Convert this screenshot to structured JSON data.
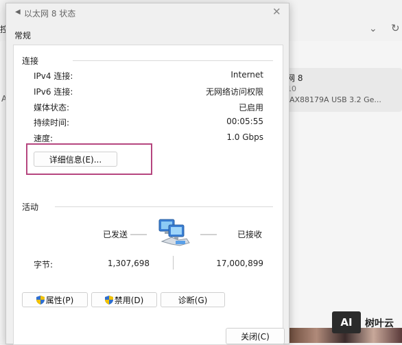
{
  "background": {
    "left_fragment": "控",
    "left_fragment2": "A",
    "card": {
      "line1": "网 8",
      "line2": "10",
      "line3": "AX88179A USB 3.2 Ge..."
    },
    "watermark": {
      "logo": "AI",
      "text": "树叶云"
    }
  },
  "dialog": {
    "title": "以太网 8 状态",
    "tab": "常规",
    "connection": {
      "title": "连接",
      "rows": [
        {
          "label": "IPv4 连接:",
          "value": "Internet"
        },
        {
          "label": "IPv6 连接:",
          "value": "无网络访问权限"
        },
        {
          "label": "媒体状态:",
          "value": "已启用"
        },
        {
          "label": "持续时间:",
          "value": "00:05:55"
        },
        {
          "label": "速度:",
          "value": "1.0 Gbps"
        }
      ],
      "details_button": "详细信息(E)..."
    },
    "activity": {
      "title": "活动",
      "sent_label": "已发送",
      "received_label": "已接收",
      "bytes_label": "字节:",
      "bytes_sent": "1,307,698",
      "bytes_received": "17,000,899"
    },
    "buttons": {
      "properties": "属性(P)",
      "disable": "禁用(D)",
      "diagnose": "诊断(G)",
      "close": "关闭(C)"
    },
    "colors": {
      "highlight": "#b5457e",
      "shield_blue": "#2f6fd0",
      "shield_yellow": "#f2c200"
    }
  }
}
